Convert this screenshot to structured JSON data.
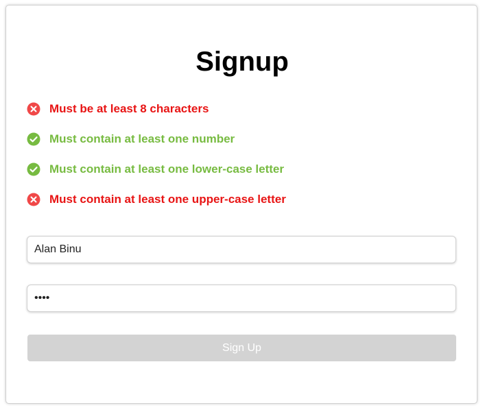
{
  "page": {
    "title": "Signup"
  },
  "rules": [
    {
      "text": "Must be at least 8 characters",
      "status": "fail"
    },
    {
      "text": "Must contain at least one number",
      "status": "pass"
    },
    {
      "text": "Must contain at least one lower-case letter",
      "status": "pass"
    },
    {
      "text": "Must contain at least one upper-case letter",
      "status": "fail"
    }
  ],
  "form": {
    "name_value": "Alan Binu",
    "password_value": "••••",
    "submit_label": "Sign Up"
  },
  "colors": {
    "fail": "#e81414",
    "pass": "#77bb41",
    "fail_icon": "#f04848",
    "pass_icon": "#77bb41",
    "button_disabled": "#d3d3d3"
  },
  "icons": {
    "fail": "x-circle-icon",
    "pass": "check-circle-icon"
  }
}
